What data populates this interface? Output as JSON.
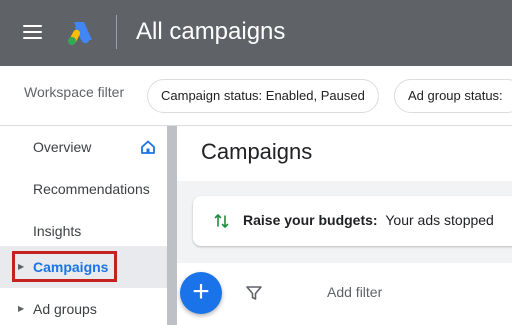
{
  "header": {
    "title": "All campaigns",
    "menu_icon": "hamburger-menu-icon",
    "logo": "google-ads-logo",
    "colors": {
      "background": "#5f6368",
      "title": "#ffffff"
    }
  },
  "filter_bar": {
    "label": "Workspace filter",
    "chips": [
      {
        "label": "Campaign status: Enabled, Paused"
      },
      {
        "label": "Ad group status:"
      }
    ]
  },
  "sidebar": {
    "items": [
      {
        "label": "Overview",
        "icon": "home-icon"
      },
      {
        "label": "Recommendations"
      },
      {
        "label": "Insights"
      },
      {
        "label": "Campaigns",
        "active": true,
        "expandable": true
      },
      {
        "label": "Ad groups",
        "expandable": true
      }
    ],
    "colors": {
      "active_bg": "#e8eaed",
      "active_text": "#1a73e8",
      "highlight_border": "#c5221f"
    }
  },
  "main": {
    "page_title": "Campaigns",
    "notice": {
      "icon": "budget-arrows-icon",
      "bold": "Raise your budgets:",
      "text": "Your ads stopped"
    },
    "toolbar": {
      "fab_label": "+",
      "filter_icon": "filter-icon",
      "add_filter_label": "Add filter"
    }
  }
}
